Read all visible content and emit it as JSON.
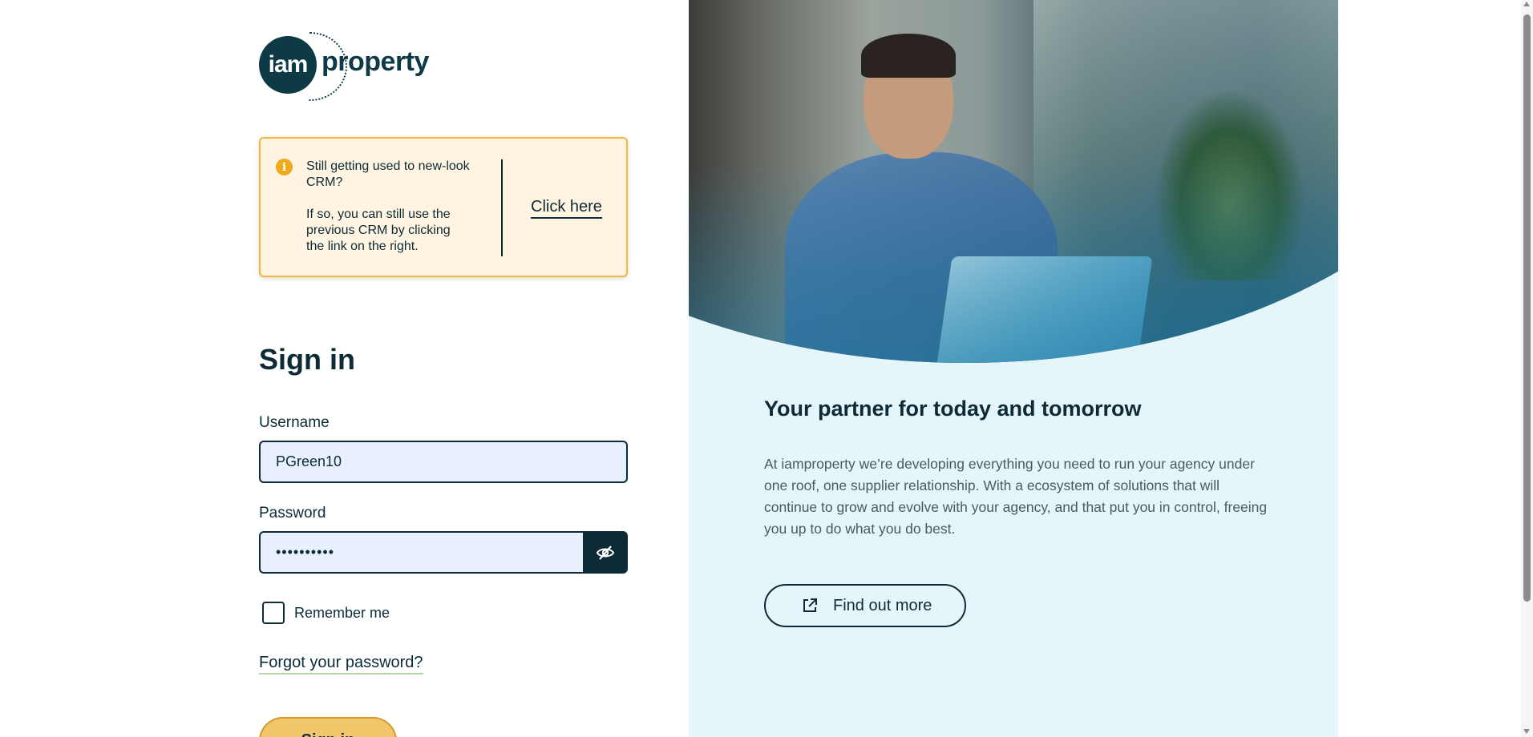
{
  "logo": {
    "mark": "iam",
    "word": "property"
  },
  "notice": {
    "icon": "info-icon",
    "title": "Still getting used to new-look CRM?",
    "body": "If so, you can still use the previous CRM by clicking the link on the right.",
    "link_label": "Click here",
    "colors": {
      "background": "#fef4e1",
      "border": "#f1b73b",
      "icon": "#f0a81c"
    }
  },
  "signin": {
    "title": "Sign in",
    "username_label": "Username",
    "username_value": "PGreen10",
    "password_label": "Password",
    "password_value": "••••••••••",
    "show_password_icon": "eye-slash-icon",
    "remember_label": "Remember me",
    "remember_checked": false,
    "forgot_label": "Forgot your password?",
    "submit_label": "Sign in"
  },
  "promo": {
    "heading": "Your partner for today and tomorrow",
    "body": "At iamproperty we’re developing everything you need to run your agency under one roof, one supplier relationship. With a ecosystem of solutions that will continue to grow and evolve with your agency, and that put you in control, freeing you up to do what you do best.",
    "button_label": "Find out more",
    "button_icon": "external-link-icon",
    "background": "#e5f6fb"
  },
  "colors": {
    "primary": "#0d2b36",
    "input_bg": "#e8f0fe",
    "submit_bg": "#f2c76b"
  }
}
